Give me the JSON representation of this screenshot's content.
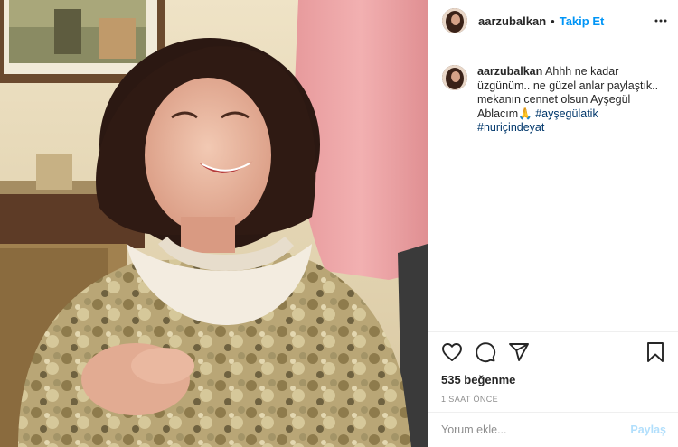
{
  "post": {
    "username": "aarzubalkan",
    "separator": "•",
    "follow_label": "Takip Et",
    "more_icon": "more-horizontal-icon",
    "photo_alt": "photo"
  },
  "caption": {
    "username": "aarzubalkan",
    "text": " Ahhh ne kadar üzgünüm.. ne güzel anlar paylaştık.. mekanın cennet olsun Ayşegül Ablacım🙏 ",
    "hashtags": [
      "#ayşegülatik",
      "#nuriçindeyat"
    ]
  },
  "actions": {
    "icons": [
      "heart-icon",
      "comment-icon",
      "share-icon",
      "bookmark-icon"
    ],
    "likes": "535 beğenme",
    "time": "1 SAAT ÖNCE"
  },
  "comment": {
    "placeholder": "Yorum ekle...",
    "post_label": "Paylaş"
  },
  "colors": {
    "accent": "#0095f6",
    "hashtag": "#00376b",
    "post_disabled": "#b2dffc",
    "muted": "#8e8e8e",
    "border": "#efefef"
  }
}
